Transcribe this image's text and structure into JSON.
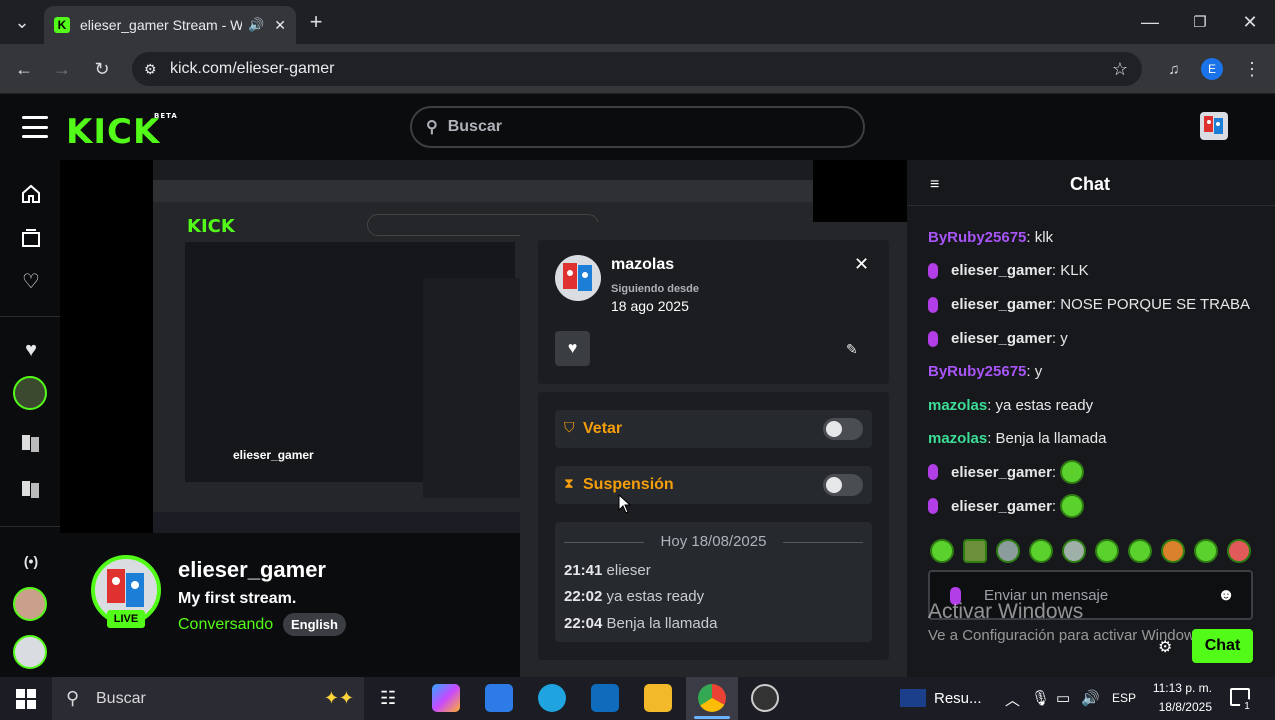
{
  "browser": {
    "tab_title": "elieser_gamer Stream - Wat",
    "url": "kick.com/elieser-gamer",
    "profile_initial": "E"
  },
  "header": {
    "logo": "KICK",
    "logo_badge": "BETA",
    "search_placeholder": "Buscar"
  },
  "popup": {
    "username": "mazolas",
    "following_label": "Siguiendo desde",
    "following_date": "18 ago 2025",
    "ban_label": "Vetar",
    "timeout_label": "Suspensión",
    "history_header": "Hoy 18/08/2025",
    "history": [
      {
        "time": "21:41",
        "text": "elieser"
      },
      {
        "time": "22:02",
        "text": "ya estas ready"
      },
      {
        "time": "22:04",
        "text": "Benja la llamada"
      }
    ]
  },
  "stream": {
    "name": "elieser_gamer",
    "title": "My first stream.",
    "category": "Conversando",
    "language": "English",
    "live_badge": "LIVE"
  },
  "chat": {
    "title": "Chat",
    "messages": [
      {
        "user": "ByRuby25675",
        "text": "klk",
        "color": "#a855f7",
        "mic": false
      },
      {
        "user": "elieser_gamer",
        "text": "KLK",
        "color": "#e6e7e9",
        "mic": true
      },
      {
        "user": "elieser_gamer",
        "text": "NOSE PORQUE SE TRABA",
        "color": "#e6e7e9",
        "mic": true
      },
      {
        "user": "elieser_gamer",
        "text": "y",
        "color": "#e6e7e9",
        "mic": true
      },
      {
        "user": "ByRuby25675",
        "text": "y",
        "color": "#a855f7",
        "mic": false
      },
      {
        "user": "mazolas",
        "text": "ya estas ready",
        "color": "#3ddc97",
        "mic": false
      },
      {
        "user": "mazolas",
        "text": "Benja la llamada",
        "color": "#3ddc97",
        "mic": false
      },
      {
        "user": "elieser_gamer",
        "text": "",
        "color": "#e6e7e9",
        "mic": true,
        "emote": true
      },
      {
        "user": "elieser_gamer",
        "text": "",
        "color": "#e6e7e9",
        "mic": true,
        "emote": true
      }
    ],
    "input_placeholder": "Enviar un mensaje",
    "send_label": "Chat",
    "watermark_title": "Activar Windows",
    "watermark_sub": "Ve a Configuración para activar Windows."
  },
  "taskbar": {
    "search_placeholder": "Buscar",
    "news": "Resu...",
    "lang": "ESP",
    "time": "11:13 p. m.",
    "date": "18/8/2025",
    "notif_count": "1"
  },
  "colors": {
    "accent": "#53fc18",
    "timeout_orange": "#f59e0b",
    "ban_orange": "#f59e0b"
  }
}
